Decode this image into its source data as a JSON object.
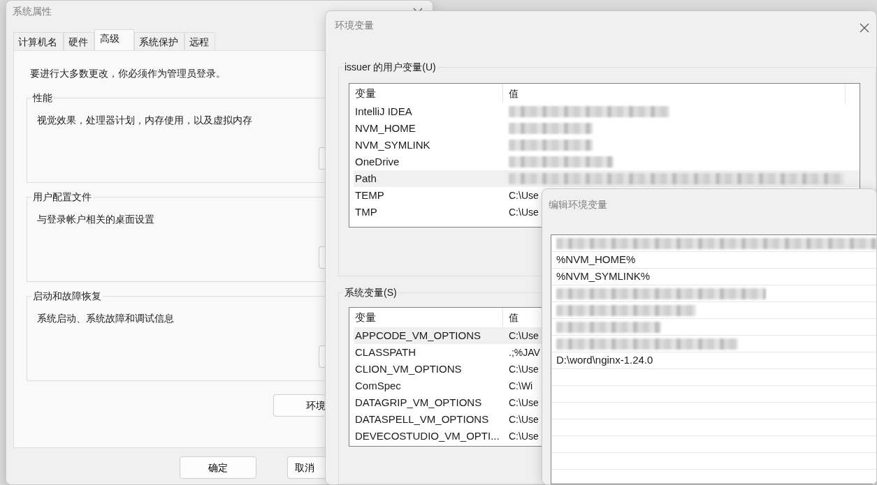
{
  "system_properties": {
    "title": "系统属性",
    "tabs": [
      {
        "label": "计算机名",
        "selected": false
      },
      {
        "label": "硬件",
        "selected": false
      },
      {
        "label": "高级",
        "selected": true
      },
      {
        "label": "系统保护",
        "selected": false
      },
      {
        "label": "远程",
        "selected": false
      }
    ],
    "notice": "要进行大多数更改，你必须作为管理员登录。",
    "groups": [
      {
        "title": "性能",
        "description": "视觉效果，处理器计划，内存使用，以及虚拟内存"
      },
      {
        "title": "用户配置文件",
        "description": "与登录帐户相关的桌面设置"
      },
      {
        "title": "启动和故障恢复",
        "description": "系统启动、系统故障和调试信息"
      }
    ],
    "env_button": "环境",
    "buttons": [
      "确定",
      "取消"
    ]
  },
  "environment_variables": {
    "title": "环境变量",
    "user_group": {
      "title": "issuer 的用户变量(U)",
      "columns": [
        "变量",
        "值"
      ],
      "rows": [
        {
          "name": "IntelliJ IDEA",
          "blurred": true,
          "selected": false
        },
        {
          "name": "NVM_HOME",
          "blurred": true,
          "selected": false
        },
        {
          "name": "NVM_SYMLINK",
          "blurred": true,
          "selected": false
        },
        {
          "name": "OneDrive",
          "blurred": true,
          "selected": false
        },
        {
          "name": "Path",
          "blurred": true,
          "selected": true
        },
        {
          "name": "TEMP",
          "value": "C:\\Use",
          "blurred": false,
          "selected": false
        },
        {
          "name": "TMP",
          "value": "C:\\Use",
          "blurred": false,
          "selected": false
        }
      ]
    },
    "system_group": {
      "title": "系统变量(S)",
      "columns": [
        "变量",
        "值"
      ],
      "rows": [
        {
          "name": "APPCODE_VM_OPTIONS",
          "value": "C:\\Use",
          "blurred": false,
          "selected": true
        },
        {
          "name": "CLASSPATH",
          "value": ".;%JAV",
          "blurred": false,
          "selected": false
        },
        {
          "name": "CLION_VM_OPTIONS",
          "value": "C:\\Use",
          "blurred": false,
          "selected": false
        },
        {
          "name": "ComSpec",
          "value": "C:\\Wi",
          "blurred": false,
          "selected": false
        },
        {
          "name": "DATAGRIP_VM_OPTIONS",
          "value": "C:\\Use",
          "blurred": false,
          "selected": false
        },
        {
          "name": "DATASPELL_VM_OPTIONS",
          "value": "C:\\Use",
          "blurred": false,
          "selected": false
        },
        {
          "name": "DEVECOSTUDIO_VM_OPTI...",
          "value": "C:\\Use",
          "blurred": false,
          "selected": false
        }
      ]
    }
  },
  "edit_variable": {
    "title": "编辑环境变量",
    "entries": [
      {
        "blurred": true
      },
      {
        "text": "%NVM_HOME%",
        "blurred": false
      },
      {
        "text": "%NVM_SYMLINK%",
        "blurred": false
      },
      {
        "blurred": true
      },
      {
        "blurred": true
      },
      {
        "blurred": true
      },
      {
        "blurred": true
      },
      {
        "text": "D:\\word\\nginx-1.24.0",
        "blurred": false
      }
    ]
  }
}
